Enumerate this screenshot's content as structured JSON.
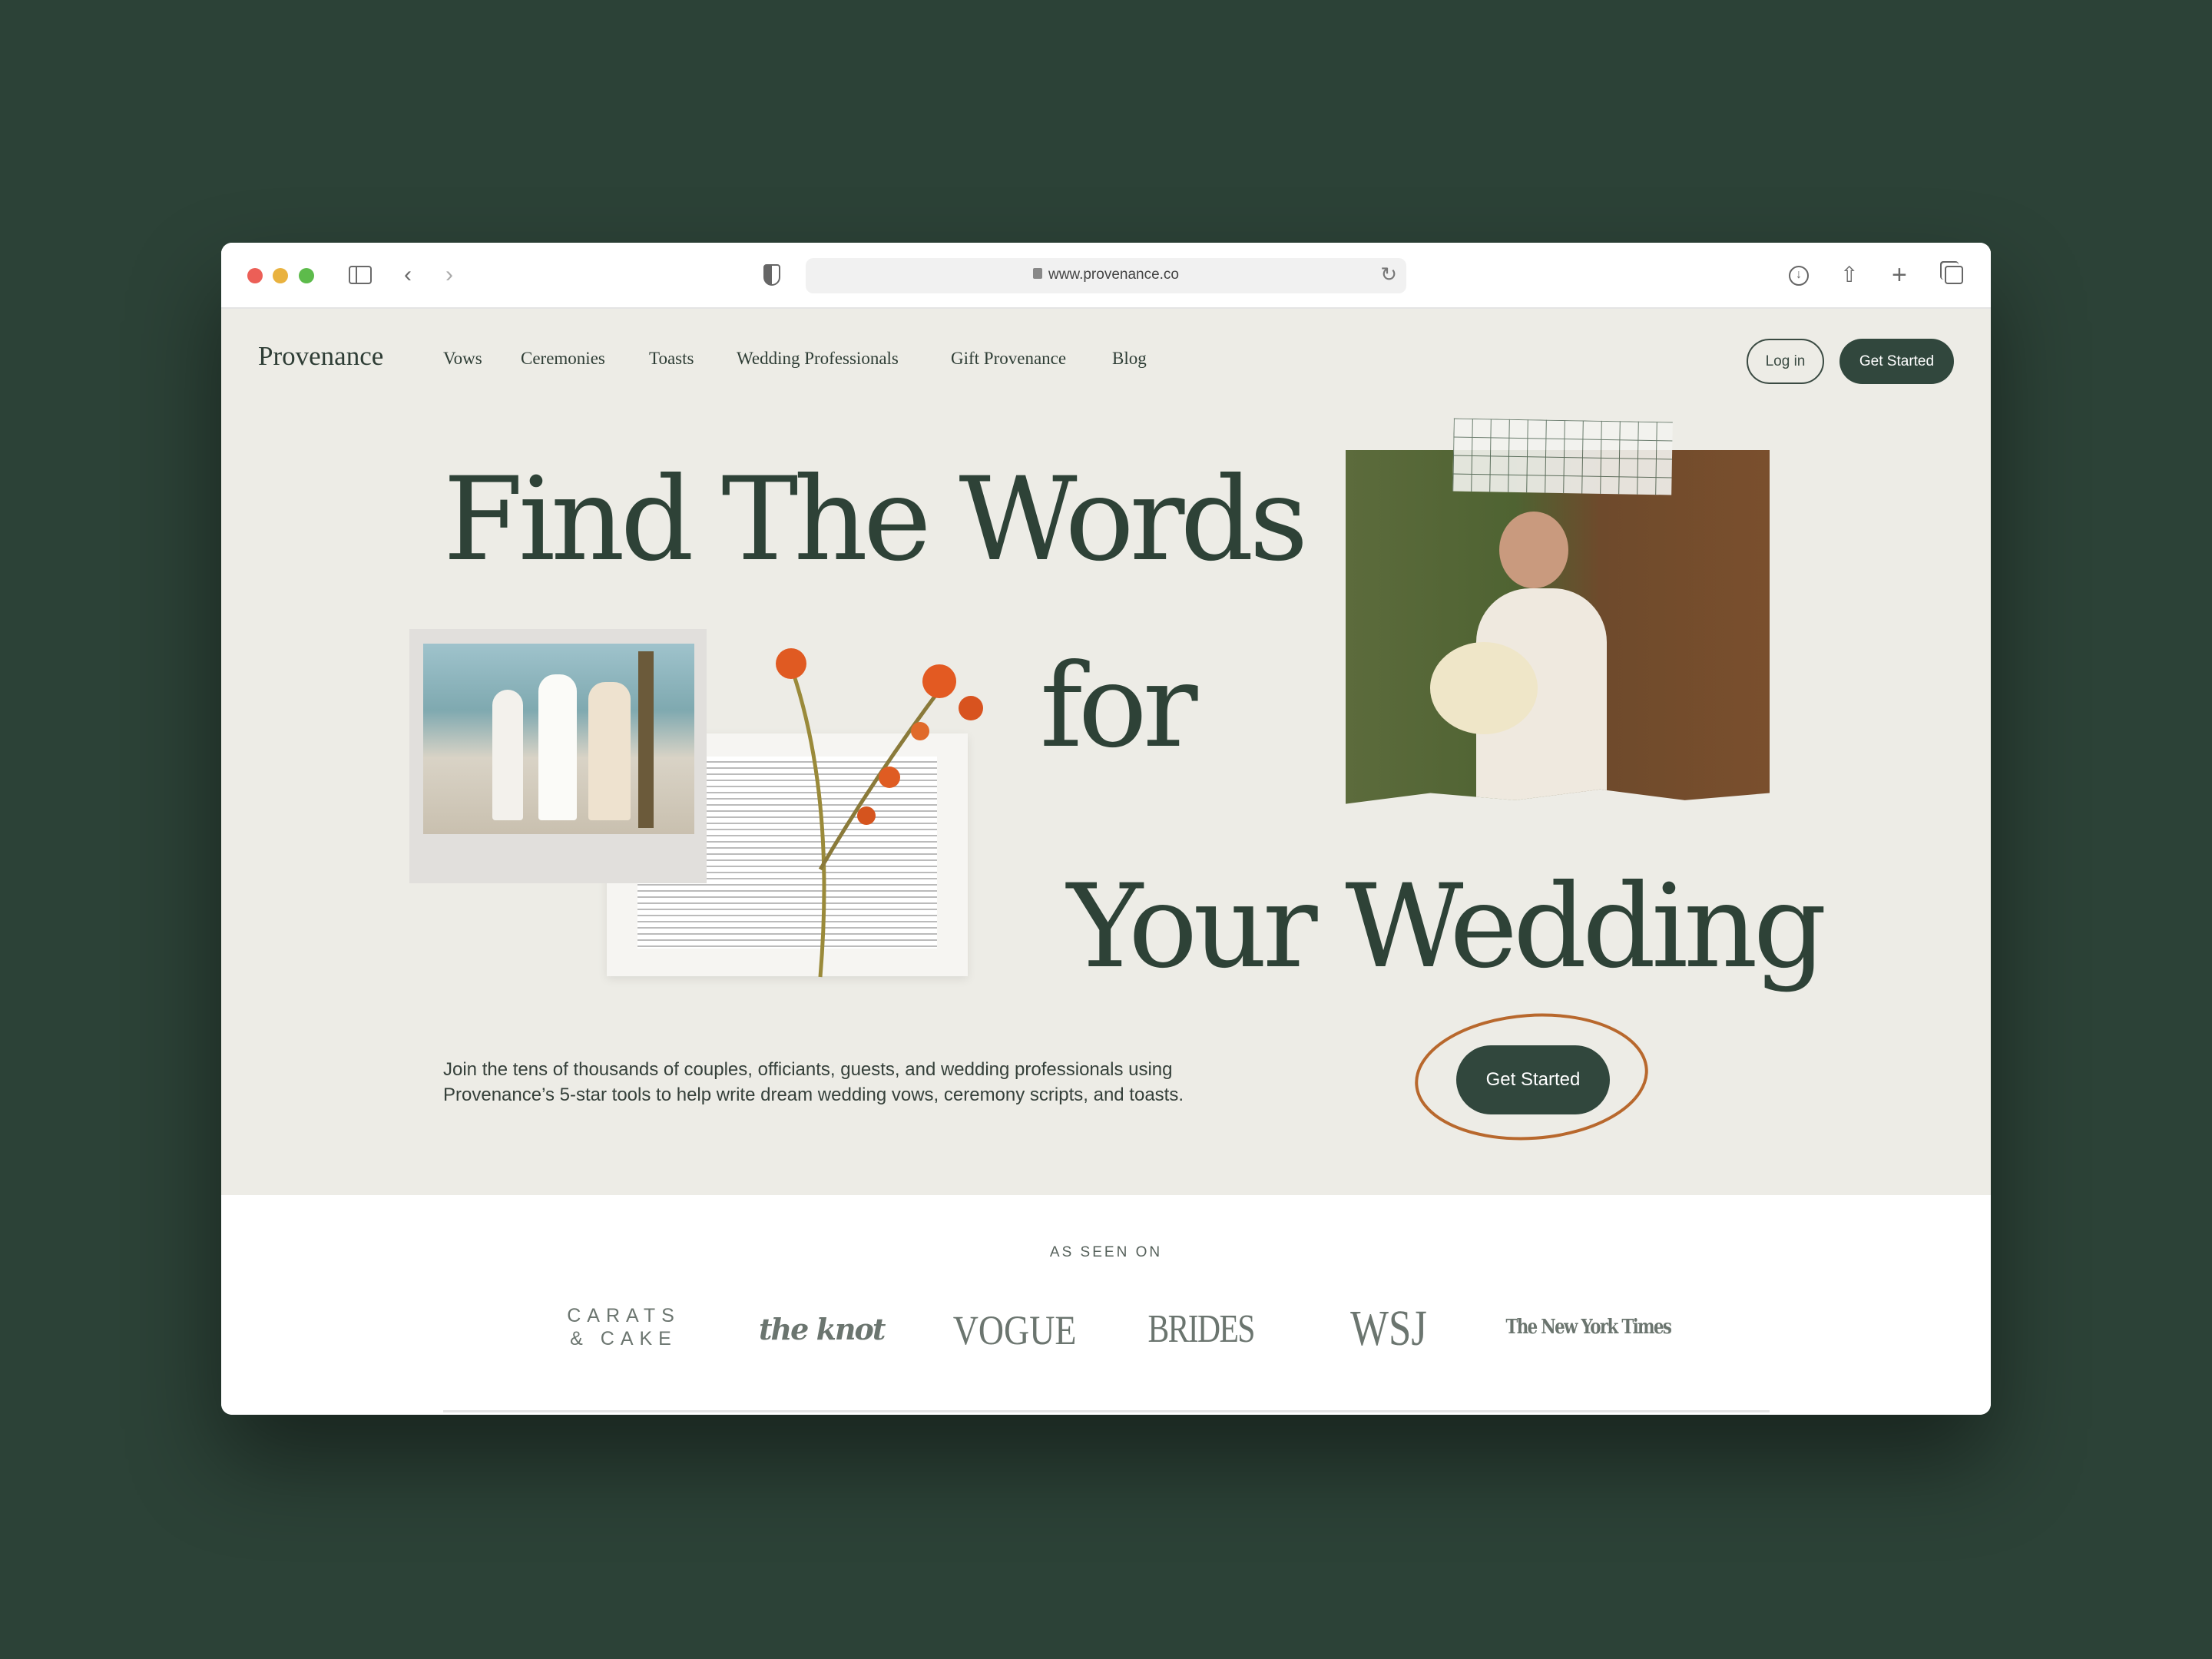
{
  "browser": {
    "url": "www.provenance.co",
    "icons": [
      "sidebar-icon",
      "back-icon",
      "forward-icon",
      "shield-icon",
      "lock-icon",
      "reload-icon",
      "download-icon",
      "share-icon",
      "new-tab-icon",
      "tabs-overview-icon"
    ]
  },
  "nav": {
    "brand": "Provenance",
    "items": [
      "Vows",
      "Ceremonies",
      "Toasts",
      "Wedding Professionals",
      "Gift Provenance",
      "Blog"
    ],
    "login": "Log in",
    "get_started": "Get Started"
  },
  "hero": {
    "line1": "Find The Words",
    "line2": "for",
    "line3": "Your Wedding",
    "description": "Join the tens of thousands of couples, officiants, guests, and wedding professionals using Provenance’s 5-star tools to help write dream wedding vows, ceremony scripts, and toasts.",
    "cta": "Get Started"
  },
  "press": {
    "heading": "AS SEEN ON",
    "logos": [
      "CARATS & CAKE",
      "the knot",
      "VOGUE",
      "BRIDES",
      "WSJ",
      "The New York Times"
    ]
  },
  "colors": {
    "background": "#2c4237",
    "hero_bg": "#edece6",
    "primary": "#31473d",
    "accent": "#b8682d"
  }
}
